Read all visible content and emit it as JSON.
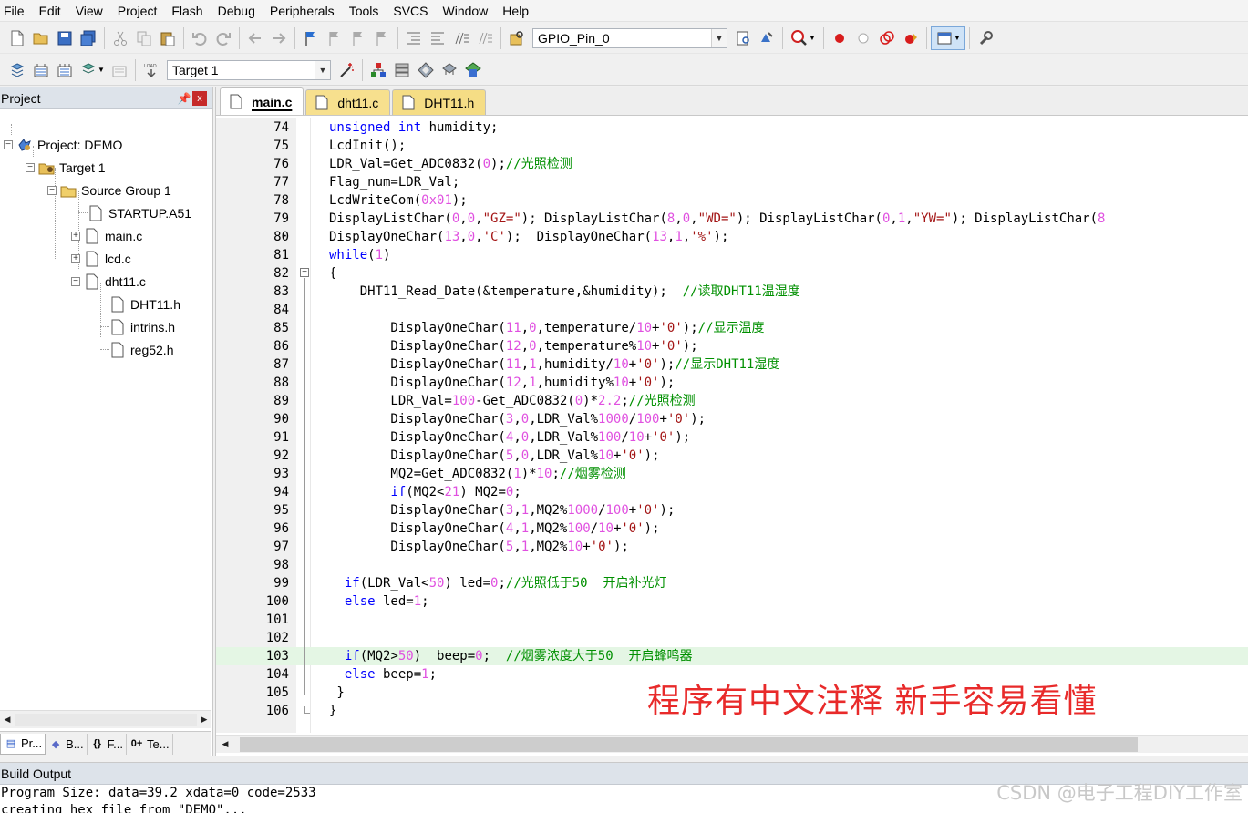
{
  "menu": [
    "File",
    "Edit",
    "View",
    "Project",
    "Flash",
    "Debug",
    "Peripherals",
    "Tools",
    "SVCS",
    "Window",
    "Help"
  ],
  "toolbar": {
    "find_value": "GPIO_Pin_0",
    "target_value": "Target 1"
  },
  "project_panel": {
    "title": "Project",
    "pin": "ᵖ",
    "close": "x",
    "nodes": [
      {
        "label": "Project: DEMO"
      },
      {
        "label": "Target 1"
      },
      {
        "label": "Source Group 1"
      },
      {
        "label": "STARTUP.A51"
      },
      {
        "label": "main.c"
      },
      {
        "label": "lcd.c"
      },
      {
        "label": "dht11.c"
      },
      {
        "label": "DHT11.h"
      },
      {
        "label": "intrins.h"
      },
      {
        "label": "reg52.h"
      }
    ],
    "tabs": [
      "Pr...",
      "B...",
      "F...",
      "Te..."
    ],
    "tab_icons": [
      "▤",
      "◆",
      "{}",
      "0+"
    ]
  },
  "editor": {
    "tabs": [
      "main.c",
      "dht11.c",
      "DHT11.h"
    ],
    "active_tab": "main.c",
    "lines": [
      {
        "n": "74",
        "t": "unsigned int humidity;"
      },
      {
        "n": "75",
        "t": "LcdInit();"
      },
      {
        "n": "76",
        "t": "LDR_Val=Get_ADC0832(0);//光照检测"
      },
      {
        "n": "77",
        "t": "Flag_num=LDR_Val;"
      },
      {
        "n": "78",
        "t": "LcdWriteCom(0x01);"
      },
      {
        "n": "79",
        "t": "DisplayListChar(0,0,\"GZ=\"); DisplayListChar(8,0,\"WD=\"); DisplayListChar(0,1,\"YW=\"); DisplayListChar(8"
      },
      {
        "n": "80",
        "t": "DisplayOneChar(13,0,'C');  DisplayOneChar(13,1,'%');"
      },
      {
        "n": "81",
        "t": "while(1)"
      },
      {
        "n": "82",
        "t": "{"
      },
      {
        "n": "83",
        "t": "    DHT11_Read_Date(&temperature,&humidity);  //读取DHT11温湿度"
      },
      {
        "n": "84",
        "t": ""
      },
      {
        "n": "85",
        "t": "        DisplayOneChar(11,0,temperature/10+'0');//显示温度"
      },
      {
        "n": "86",
        "t": "        DisplayOneChar(12,0,temperature%10+'0');"
      },
      {
        "n": "87",
        "t": "        DisplayOneChar(11,1,humidity/10+'0');//显示DHT11湿度"
      },
      {
        "n": "88",
        "t": "        DisplayOneChar(12,1,humidity%10+'0');"
      },
      {
        "n": "89",
        "t": "        LDR_Val=100-Get_ADC0832(0)*2.2;//光照检测"
      },
      {
        "n": "90",
        "t": "        DisplayOneChar(3,0,LDR_Val%1000/100+'0');"
      },
      {
        "n": "91",
        "t": "        DisplayOneChar(4,0,LDR_Val%100/10+'0');"
      },
      {
        "n": "92",
        "t": "        DisplayOneChar(5,0,LDR_Val%10+'0');"
      },
      {
        "n": "93",
        "t": "        MQ2=Get_ADC0832(1)*10;//烟雾检测"
      },
      {
        "n": "94",
        "t": "        if(MQ2<21) MQ2=0;"
      },
      {
        "n": "95",
        "t": "        DisplayOneChar(3,1,MQ2%1000/100+'0');"
      },
      {
        "n": "96",
        "t": "        DisplayOneChar(4,1,MQ2%100/10+'0');"
      },
      {
        "n": "97",
        "t": "        DisplayOneChar(5,1,MQ2%10+'0');"
      },
      {
        "n": "98",
        "t": ""
      },
      {
        "n": "99",
        "t": "  if(LDR_Val<50) led=0;//光照低于50  开启补光灯"
      },
      {
        "n": "100",
        "t": "  else led=1;"
      },
      {
        "n": "101",
        "t": ""
      },
      {
        "n": "102",
        "t": ""
      },
      {
        "n": "103",
        "t": "  if(MQ2>50)  beep=0;  //烟雾浓度大于50  开启蜂鸣器"
      },
      {
        "n": "104",
        "t": "  else beep=1;"
      },
      {
        "n": "105",
        "t": " }"
      },
      {
        "n": "106",
        "t": "}"
      }
    ],
    "overlay_text": "程序有中文注释  新手容易看懂"
  },
  "build_output": {
    "title": "Build Output",
    "lines": [
      "Program Size: data=39.2 xdata=0 code=2533",
      "creating hex file from \"DEMO\"..."
    ]
  },
  "watermark": "CSDN @电子工程DIY工作室"
}
